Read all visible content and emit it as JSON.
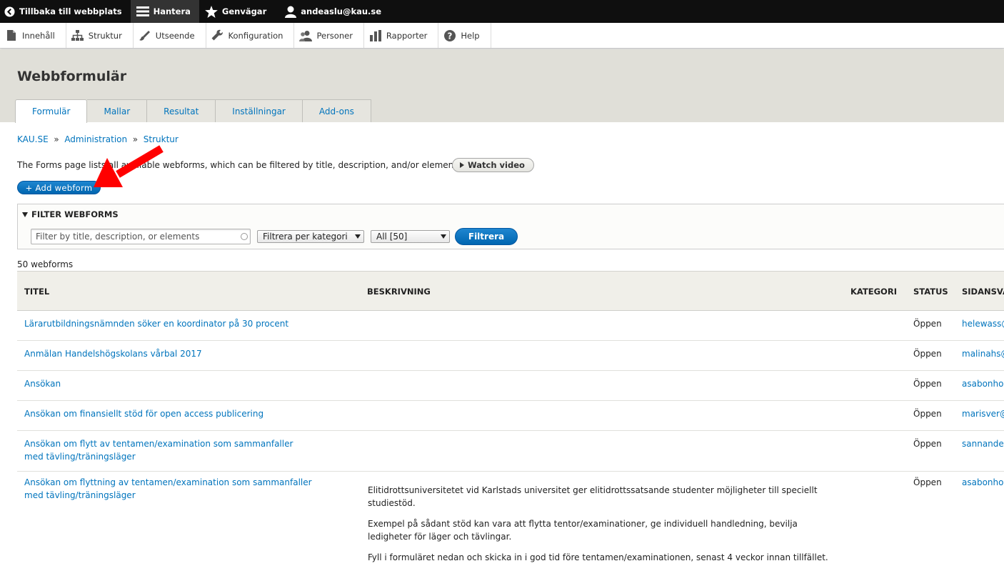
{
  "topbar": {
    "back_label": "Tillbaka till webbplats",
    "manage_label": "Hantera",
    "shortcuts_label": "Genvägar",
    "user_label": "andeaslu@kau.se"
  },
  "tray": {
    "items": [
      {
        "label": "Innehåll",
        "icon": "file-icon"
      },
      {
        "label": "Struktur",
        "icon": "sitemap-icon"
      },
      {
        "label": "Utseende",
        "icon": "paintbrush-icon"
      },
      {
        "label": "Konfiguration",
        "icon": "wrench-icon"
      },
      {
        "label": "Personer",
        "icon": "people-icon"
      },
      {
        "label": "Rapporter",
        "icon": "bar-chart-icon"
      },
      {
        "label": "Help",
        "icon": "question-icon"
      }
    ]
  },
  "header": {
    "title": "Webbformulär",
    "tabs": [
      {
        "label": "Formulär"
      },
      {
        "label": "Mallar"
      },
      {
        "label": "Resultat"
      },
      {
        "label": "Inställningar"
      },
      {
        "label": "Add-ons"
      }
    ]
  },
  "breadcrumb": {
    "items": [
      "KAU.SE",
      "Administration",
      "Struktur"
    ],
    "separator": "»"
  },
  "intro": {
    "text": "The Forms page lists all available webforms, which can be filtered by title, description, and/or elements.",
    "watch_video_label": "Watch video"
  },
  "add_webform_label": "+ Add webform",
  "filter": {
    "legend": "FILTER WEBFORMS",
    "search_placeholder": "Filter by title, description, or elements",
    "category_select": "Filtrera per kategori",
    "state_select": "All [50]",
    "submit_label": "Filtrera"
  },
  "count_text": "50 webforms",
  "table": {
    "headers": {
      "title": "TITEL",
      "description": "BESKRIVNING",
      "category": "KATEGORI",
      "status": "STATUS",
      "owner": "SIDANSVARIG"
    },
    "rows": [
      {
        "title": "Lärarutbildningsnämnden söker en koordinator på 30 procent",
        "status": "Öppen",
        "owner": "helewass@kau.se"
      },
      {
        "title": "Anmälan Handelshögskolans vårbal 2017",
        "status": "Öppen",
        "owner": "malinahs@kau.se"
      },
      {
        "title": "Ansökan",
        "status": "Öppen",
        "owner": "asabonho@kau.se"
      },
      {
        "title": "Ansökan om finansiellt stöd för open access publicering",
        "status": "Öppen",
        "owner": "marisver@kau.se"
      },
      {
        "title": "Ansökan om flytt av tentamen/examination som sammanfaller med tävling/träningsläger",
        "status": "Öppen",
        "owner": "sannande@kau.se"
      },
      {
        "title": "Ansökan om flyttning av tentamen/examination som sammanfaller med tävling/träningsläger",
        "status": "Öppen",
        "owner": "asabonho@kau.se",
        "description": [
          "Elitidrottsuniversitetet vid Karlstads universitet ger elitidrottssatsande studenter möjligheter till speciellt studiestöd.",
          "Exempel på sådant stöd kan vara att flytta tentor/examinationer, ge individuell handledning, bevilja ledigheter för läger och tävlingar.",
          "Fyll i formuläret nedan och skicka in i god tid före tentamen/examinationen, senast 4 veckor innan tillfället."
        ]
      }
    ]
  },
  "colors": {
    "link": "#0074bd",
    "primary_button": "#0068b4",
    "toolbar": "#0f0f0f",
    "header_bg": "#e0dfd8",
    "annotation_arrow": "#ff0000"
  }
}
